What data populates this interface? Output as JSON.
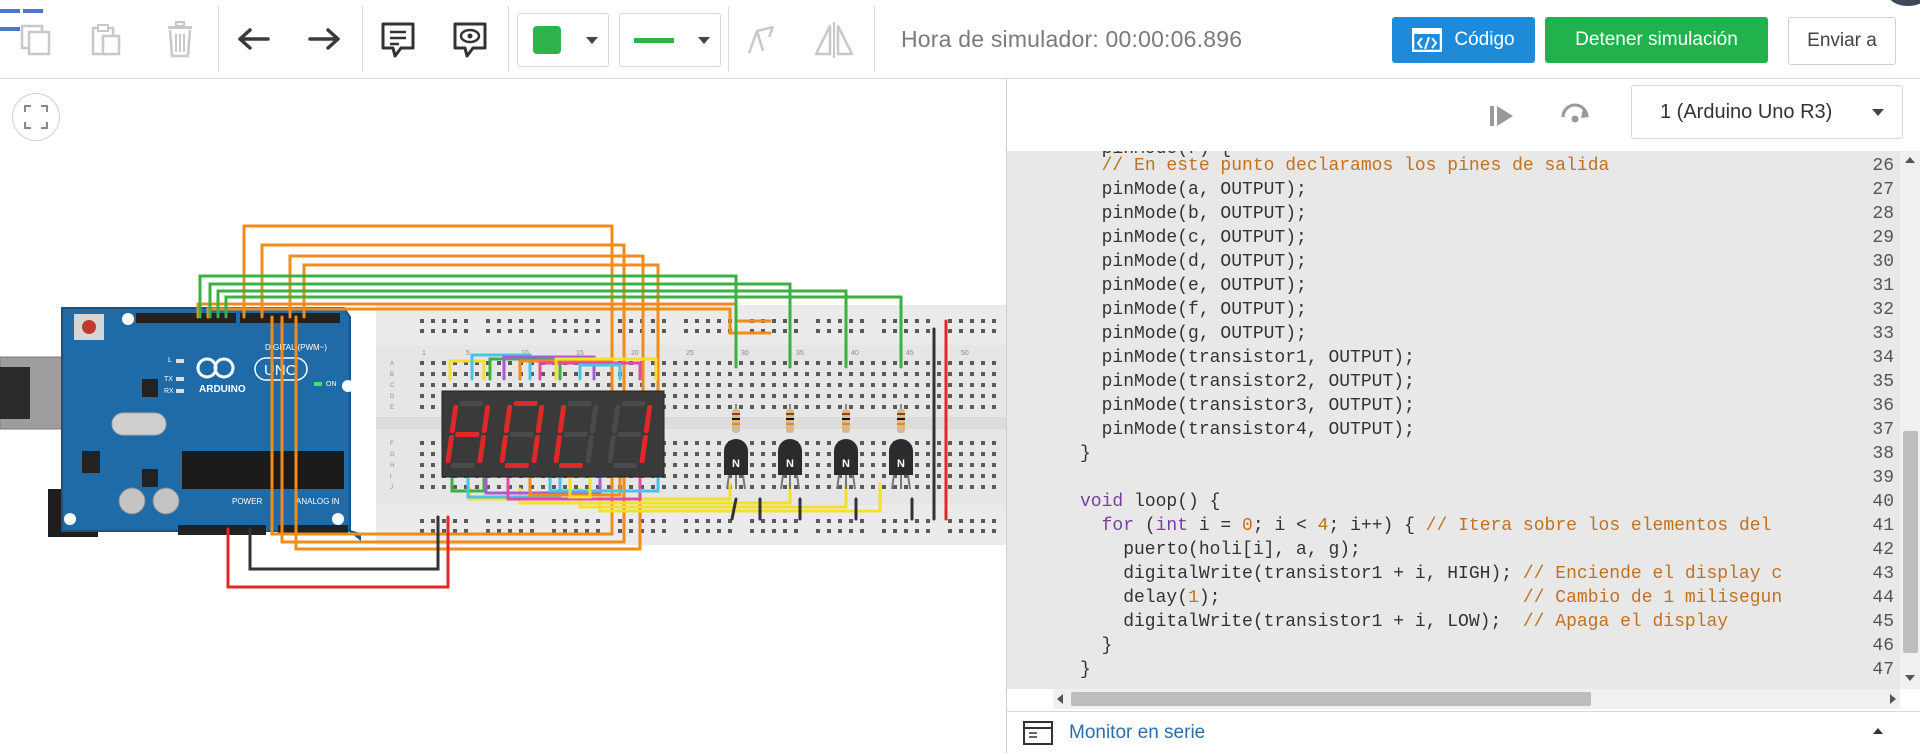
{
  "toolbar": {
    "sim_time": "Hora de simulador: 00:00:06.896",
    "code_button": "Código",
    "stop_button": "Detener simulación",
    "send_button": "Enviar a",
    "fill_color": "#2db34a",
    "icons": [
      "copy-icon",
      "paste-icon",
      "delete-icon",
      "undo-icon",
      "redo-icon",
      "note-icon",
      "visibility-icon",
      "color-swatch-icon",
      "line-style-icon",
      "rotate-icon",
      "flip-icon"
    ]
  },
  "code_panel": {
    "board_select": "1 (Arduino Uno R3)",
    "serial_monitor": "Monitor en serie",
    "code_lines": [
      {
        "n": "26",
        "html": "  <span class=\"cm\">// En este punto declaramos los pines de salida</span>"
      },
      {
        "n": "27",
        "html": "  pinMode(a, OUTPUT);"
      },
      {
        "n": "28",
        "html": "  pinMode(b, OUTPUT);"
      },
      {
        "n": "29",
        "html": "  pinMode(c, OUTPUT);"
      },
      {
        "n": "30",
        "html": "  pinMode(d, OUTPUT);"
      },
      {
        "n": "31",
        "html": "  pinMode(e, OUTPUT);"
      },
      {
        "n": "32",
        "html": "  pinMode(f, OUTPUT);"
      },
      {
        "n": "33",
        "html": "  pinMode(g, OUTPUT);"
      },
      {
        "n": "34",
        "html": "  pinMode(transistor1, OUTPUT);"
      },
      {
        "n": "35",
        "html": "  pinMode(transistor2, OUTPUT);"
      },
      {
        "n": "36",
        "html": "  pinMode(transistor3, OUTPUT);"
      },
      {
        "n": "37",
        "html": "  pinMode(transistor4, OUTPUT);"
      },
      {
        "n": "38",
        "html": "}"
      },
      {
        "n": "39",
        "html": ""
      },
      {
        "n": "40",
        "html": "<span class=\"kw\">void</span> loop() {"
      },
      {
        "n": "41",
        "html": "  <span class=\"kw\">for</span> (<span class=\"kw\">int</span> i = <span class=\"nm\">0</span>; i &lt; <span class=\"nm\">4</span>; i++) { <span class=\"cm\">// Itera sobre los elementos del</span>"
      },
      {
        "n": "42",
        "html": "    puerto(holi[i], a, g);"
      },
      {
        "n": "43",
        "html": "    digitalWrite(transistor1 + i, HIGH); <span class=\"cm\">// Enciende el display c</span>"
      },
      {
        "n": "44",
        "html": "    delay(<span class=\"nm\">1</span>);                            <span class=\"cm\">// Cambio de 1 milisegun</span>"
      },
      {
        "n": "45",
        "html": "    digitalWrite(transistor1 + i, LOW);  <span class=\"cm\">// Apaga el display</span>"
      },
      {
        "n": "46",
        "html": "  }"
      },
      {
        "n": "47",
        "html": "}"
      }
    ]
  },
  "circuit": {
    "arduino_logo": "ARDUINO",
    "arduino_model": "UNO",
    "digital_label": "DIGITAL (PWM~)",
    "power_label": "POWER",
    "analog_label": "ANALOG IN",
    "on_label": "ON",
    "tx_label": "TX",
    "rx_label": "RX",
    "l_label": "L",
    "display_chars": [
      "H",
      "O",
      "L",
      "I"
    ],
    "display_color": "#e02828",
    "transistor_label": "N",
    "breadboard_numbers": [
      "1",
      "5",
      "10",
      "15",
      "20",
      "25",
      "30",
      "35",
      "40",
      "45",
      "50"
    ],
    "breadboard_rows": [
      "A",
      "B",
      "C",
      "D",
      "E",
      "F",
      "G",
      "H",
      "I",
      "J"
    ]
  }
}
